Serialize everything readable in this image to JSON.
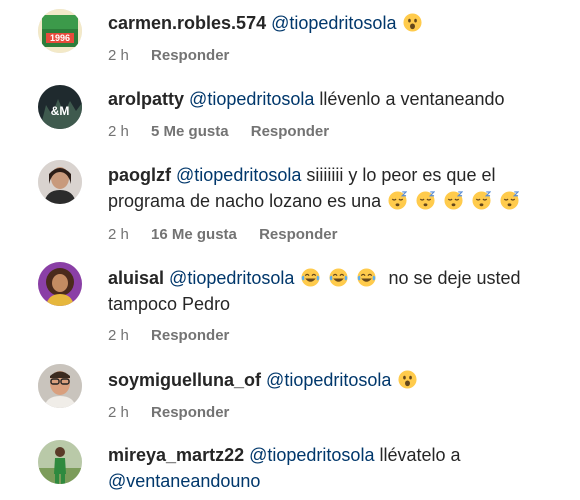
{
  "comments": [
    {
      "username": "carmen.robles.574",
      "mention": "@tiopedritosola",
      "text": "",
      "emoji": "astonished-face-emoji",
      "avatar_label": "1996",
      "time": "2 h",
      "likes": "",
      "reply": "Responder"
    },
    {
      "username": "arolpatty",
      "mention": "@tiopedritosola",
      "text": "llévenlo a ventaneando",
      "avatar_label": "&M",
      "time": "2 h",
      "likes": "5 Me gusta",
      "reply": "Responder"
    },
    {
      "username": "paoglzf",
      "mention": "@tiopedritosola",
      "text_line1": "siiiiiii y lo peor es que el",
      "text_line2": "programa de nacho lozano es una",
      "emoji": "sleeping-face-emoji",
      "emoji_count": 5,
      "time": "2 h",
      "likes": "16 Me gusta",
      "reply": "Responder"
    },
    {
      "username": "aluisal",
      "mention": "@tiopedritosola",
      "emoji": "face-with-tears-of-joy-emoji",
      "emoji_count": 3,
      "text_line1": "no se deje usted",
      "text_line2": "tampoco Pedro",
      "time": "2 h",
      "likes": "",
      "reply": "Responder"
    },
    {
      "username": "soymiguelluna_of",
      "mention": "@tiopedritosola",
      "emoji": "astonished-face-emoji",
      "time": "2 h",
      "likes": "",
      "reply": "Responder"
    },
    {
      "username": "mireya_martz22",
      "mention": "@tiopedritosola",
      "text_line1": "llévatelo a",
      "mention2": "@ventaneandouno"
    }
  ],
  "colors": {
    "text": "#262626",
    "mention": "#00376b",
    "meta": "#737373"
  }
}
